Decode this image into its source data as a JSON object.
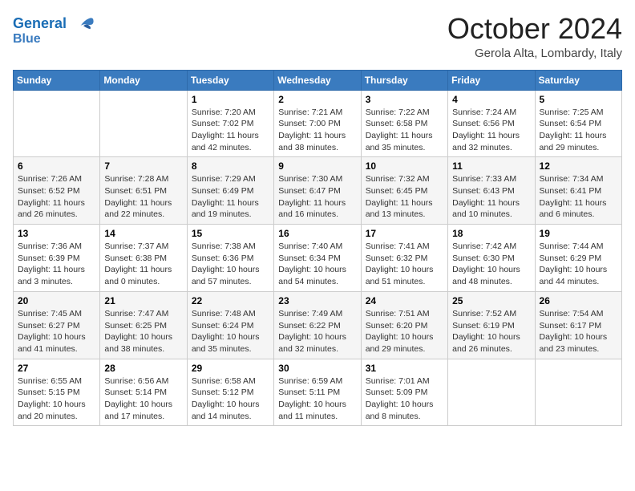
{
  "header": {
    "logo_line1": "General",
    "logo_line2": "Blue",
    "title": "October 2024",
    "location": "Gerola Alta, Lombardy, Italy"
  },
  "days_of_week": [
    "Sunday",
    "Monday",
    "Tuesday",
    "Wednesday",
    "Thursday",
    "Friday",
    "Saturday"
  ],
  "weeks": [
    [
      {
        "day": "",
        "info": ""
      },
      {
        "day": "",
        "info": ""
      },
      {
        "day": "1",
        "info": "Sunrise: 7:20 AM\nSunset: 7:02 PM\nDaylight: 11 hours and 42 minutes."
      },
      {
        "day": "2",
        "info": "Sunrise: 7:21 AM\nSunset: 7:00 PM\nDaylight: 11 hours and 38 minutes."
      },
      {
        "day": "3",
        "info": "Sunrise: 7:22 AM\nSunset: 6:58 PM\nDaylight: 11 hours and 35 minutes."
      },
      {
        "day": "4",
        "info": "Sunrise: 7:24 AM\nSunset: 6:56 PM\nDaylight: 11 hours and 32 minutes."
      },
      {
        "day": "5",
        "info": "Sunrise: 7:25 AM\nSunset: 6:54 PM\nDaylight: 11 hours and 29 minutes."
      }
    ],
    [
      {
        "day": "6",
        "info": "Sunrise: 7:26 AM\nSunset: 6:52 PM\nDaylight: 11 hours and 26 minutes."
      },
      {
        "day": "7",
        "info": "Sunrise: 7:28 AM\nSunset: 6:51 PM\nDaylight: 11 hours and 22 minutes."
      },
      {
        "day": "8",
        "info": "Sunrise: 7:29 AM\nSunset: 6:49 PM\nDaylight: 11 hours and 19 minutes."
      },
      {
        "day": "9",
        "info": "Sunrise: 7:30 AM\nSunset: 6:47 PM\nDaylight: 11 hours and 16 minutes."
      },
      {
        "day": "10",
        "info": "Sunrise: 7:32 AM\nSunset: 6:45 PM\nDaylight: 11 hours and 13 minutes."
      },
      {
        "day": "11",
        "info": "Sunrise: 7:33 AM\nSunset: 6:43 PM\nDaylight: 11 hours and 10 minutes."
      },
      {
        "day": "12",
        "info": "Sunrise: 7:34 AM\nSunset: 6:41 PM\nDaylight: 11 hours and 6 minutes."
      }
    ],
    [
      {
        "day": "13",
        "info": "Sunrise: 7:36 AM\nSunset: 6:39 PM\nDaylight: 11 hours and 3 minutes."
      },
      {
        "day": "14",
        "info": "Sunrise: 7:37 AM\nSunset: 6:38 PM\nDaylight: 11 hours and 0 minutes."
      },
      {
        "day": "15",
        "info": "Sunrise: 7:38 AM\nSunset: 6:36 PM\nDaylight: 10 hours and 57 minutes."
      },
      {
        "day": "16",
        "info": "Sunrise: 7:40 AM\nSunset: 6:34 PM\nDaylight: 10 hours and 54 minutes."
      },
      {
        "day": "17",
        "info": "Sunrise: 7:41 AM\nSunset: 6:32 PM\nDaylight: 10 hours and 51 minutes."
      },
      {
        "day": "18",
        "info": "Sunrise: 7:42 AM\nSunset: 6:30 PM\nDaylight: 10 hours and 48 minutes."
      },
      {
        "day": "19",
        "info": "Sunrise: 7:44 AM\nSunset: 6:29 PM\nDaylight: 10 hours and 44 minutes."
      }
    ],
    [
      {
        "day": "20",
        "info": "Sunrise: 7:45 AM\nSunset: 6:27 PM\nDaylight: 10 hours and 41 minutes."
      },
      {
        "day": "21",
        "info": "Sunrise: 7:47 AM\nSunset: 6:25 PM\nDaylight: 10 hours and 38 minutes."
      },
      {
        "day": "22",
        "info": "Sunrise: 7:48 AM\nSunset: 6:24 PM\nDaylight: 10 hours and 35 minutes."
      },
      {
        "day": "23",
        "info": "Sunrise: 7:49 AM\nSunset: 6:22 PM\nDaylight: 10 hours and 32 minutes."
      },
      {
        "day": "24",
        "info": "Sunrise: 7:51 AM\nSunset: 6:20 PM\nDaylight: 10 hours and 29 minutes."
      },
      {
        "day": "25",
        "info": "Sunrise: 7:52 AM\nSunset: 6:19 PM\nDaylight: 10 hours and 26 minutes."
      },
      {
        "day": "26",
        "info": "Sunrise: 7:54 AM\nSunset: 6:17 PM\nDaylight: 10 hours and 23 minutes."
      }
    ],
    [
      {
        "day": "27",
        "info": "Sunrise: 6:55 AM\nSunset: 5:15 PM\nDaylight: 10 hours and 20 minutes."
      },
      {
        "day": "28",
        "info": "Sunrise: 6:56 AM\nSunset: 5:14 PM\nDaylight: 10 hours and 17 minutes."
      },
      {
        "day": "29",
        "info": "Sunrise: 6:58 AM\nSunset: 5:12 PM\nDaylight: 10 hours and 14 minutes."
      },
      {
        "day": "30",
        "info": "Sunrise: 6:59 AM\nSunset: 5:11 PM\nDaylight: 10 hours and 11 minutes."
      },
      {
        "day": "31",
        "info": "Sunrise: 7:01 AM\nSunset: 5:09 PM\nDaylight: 10 hours and 8 minutes."
      },
      {
        "day": "",
        "info": ""
      },
      {
        "day": "",
        "info": ""
      }
    ]
  ]
}
